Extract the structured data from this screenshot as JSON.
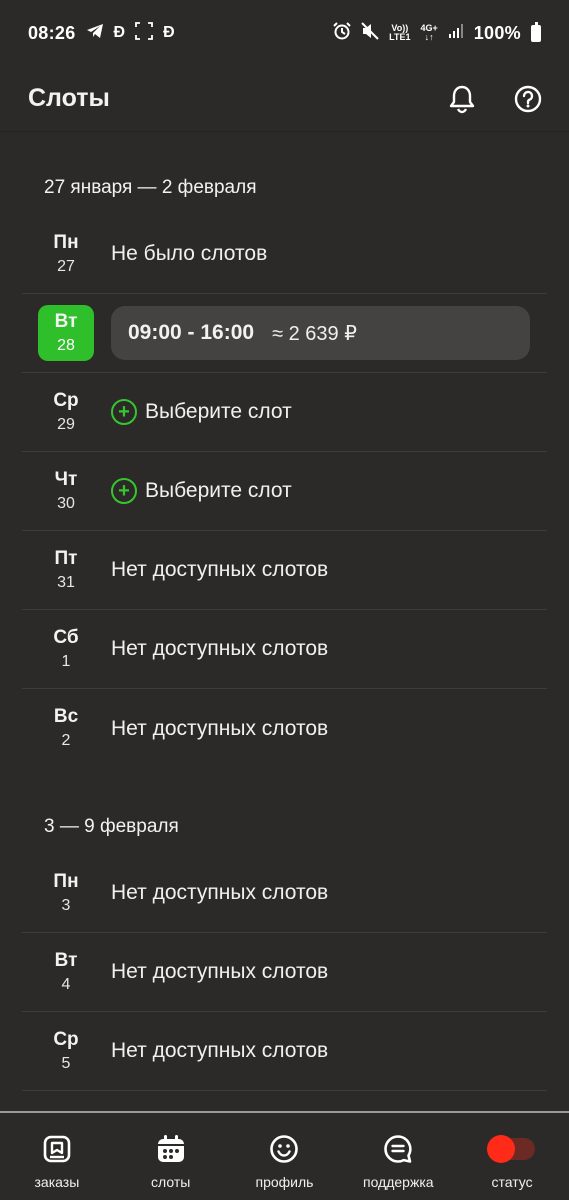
{
  "status_bar": {
    "time": "08:26",
    "left_icons": [
      "telegram-icon",
      "coin-d-icon",
      "screenshot-icon",
      "coin-d-icon"
    ],
    "right_icons": [
      "alarm-icon",
      "mute-icon",
      "volte-icon",
      "4g-icon",
      "signal-icon"
    ],
    "volte_top": "Vo))",
    "volte_bottom": "LTE1",
    "net_top": "4G+",
    "net_bottom": "↓↑",
    "battery": "100%"
  },
  "header": {
    "title": "Слоты",
    "bell_icon": "bell-icon",
    "help_icon": "help-circle-icon"
  },
  "weeks": [
    {
      "title": "27 января — 2 февраля",
      "days": [
        {
          "name": "Пн",
          "num": "27",
          "kind": "text",
          "text": "Не было слотов"
        },
        {
          "name": "Вт",
          "num": "28",
          "kind": "slot",
          "time": "09:00 - 16:00",
          "price": "≈ 2 639 ₽"
        },
        {
          "name": "Ср",
          "num": "29",
          "kind": "choose",
          "text": "Выберите слот"
        },
        {
          "name": "Чт",
          "num": "30",
          "kind": "choose",
          "text": "Выберите слот"
        },
        {
          "name": "Пт",
          "num": "31",
          "kind": "text",
          "text": "Нет доступных слотов"
        },
        {
          "name": "Сб",
          "num": "1",
          "kind": "text",
          "text": "Нет доступных слотов"
        },
        {
          "name": "Вс",
          "num": "2",
          "kind": "text",
          "text": "Нет доступных слотов"
        }
      ]
    },
    {
      "title": "3 — 9 февраля",
      "days": [
        {
          "name": "Пн",
          "num": "3",
          "kind": "text",
          "text": "Нет доступных слотов"
        },
        {
          "name": "Вт",
          "num": "4",
          "kind": "text",
          "text": "Нет доступных слотов"
        },
        {
          "name": "Ср",
          "num": "5",
          "kind": "text",
          "text": "Нет доступных слотов"
        }
      ]
    }
  ],
  "bottom_nav": [
    {
      "label": "заказы",
      "icon": "orders-box-icon"
    },
    {
      "label": "слоты",
      "icon": "calendar-icon"
    },
    {
      "label": "профиль",
      "icon": "smiley-icon"
    },
    {
      "label": "поддержка",
      "icon": "chat-bubble-icon"
    },
    {
      "label": "статус",
      "icon": "status-toggle-icon"
    }
  ],
  "colors": {
    "background": "#2b2a29",
    "accent_green": "#2fbf2b",
    "status_red": "#ff2a17",
    "slot_pill": "#444342"
  }
}
